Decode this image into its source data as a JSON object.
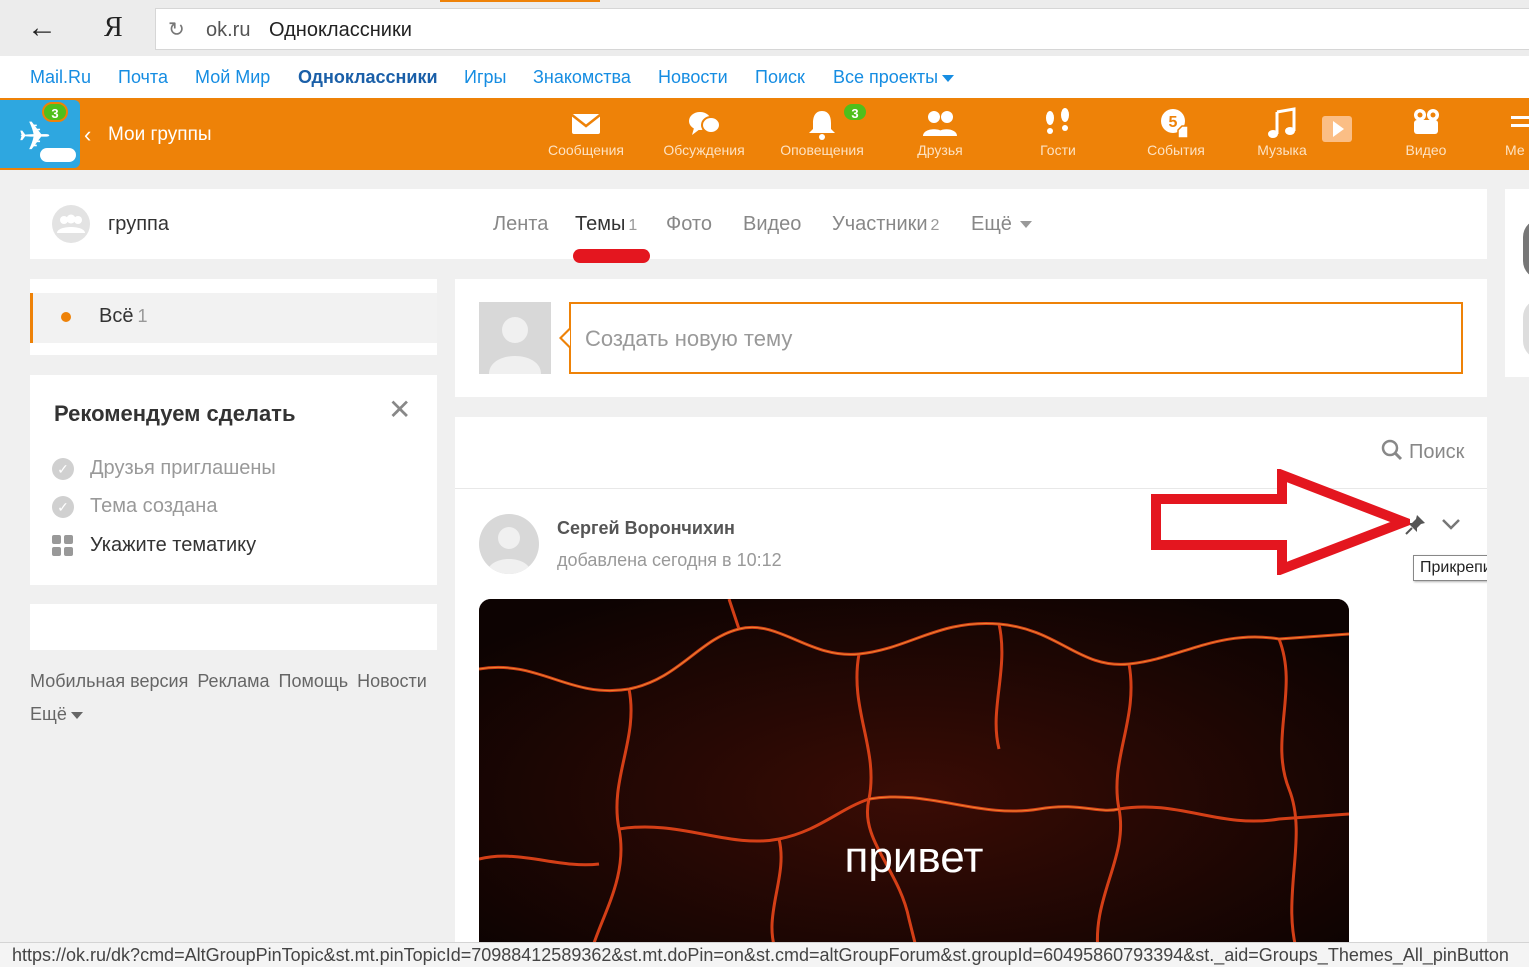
{
  "browser": {
    "back_icon": "arrow-left-icon",
    "logo": "Я",
    "domain": "ok.ru",
    "page_title": "Одноклассники"
  },
  "portal_nav": {
    "items": [
      "Mail.Ru",
      "Почта",
      "Мой Мир",
      "Одноклассники",
      "Игры",
      "Знакомства",
      "Новости",
      "Поиск",
      "Все проекты"
    ]
  },
  "header": {
    "logo_badge": "3",
    "section_title": "Мои группы",
    "nav": [
      {
        "label": "Сообщения",
        "icon": "envelope-icon"
      },
      {
        "label": "Обсуждения",
        "icon": "chat-bubbles-icon"
      },
      {
        "label": "Оповещения",
        "icon": "bell-icon",
        "badge": "3"
      },
      {
        "label": "Друзья",
        "icon": "friends-icon"
      },
      {
        "label": "Гости",
        "icon": "footprints-icon"
      },
      {
        "label": "События",
        "icon": "events-icon",
        "badge": "5"
      },
      {
        "label": "Музыка",
        "icon": "music-note-icon"
      },
      {
        "label": "Видео",
        "icon": "video-camera-icon"
      },
      {
        "label": "Ме",
        "icon": "menu-icon"
      }
    ],
    "accent_color": "#ee8208",
    "badge_color": "#4fbf1b"
  },
  "group": {
    "name": "группа",
    "tabs": [
      {
        "label": "Лента",
        "count": ""
      },
      {
        "label": "Темы",
        "count": "1"
      },
      {
        "label": "Фото",
        "count": ""
      },
      {
        "label": "Видео",
        "count": ""
      },
      {
        "label": "Участники",
        "count": "2"
      },
      {
        "label": "Ещё",
        "count": ""
      }
    ],
    "active_tab": "Темы"
  },
  "filter": {
    "label": "Всё",
    "count": "1"
  },
  "recommend": {
    "title": "Рекомендуем сделать",
    "items": [
      {
        "label": "Друзья приглашены",
        "done": true
      },
      {
        "label": "Тема создана",
        "done": true
      },
      {
        "label": "Укажите тематику",
        "done": false
      }
    ]
  },
  "footer": {
    "links": [
      "Мобильная версия",
      "Реклама",
      "Помощь",
      "Новости"
    ],
    "more": "Ещё"
  },
  "compose": {
    "placeholder": "Создать новую тему"
  },
  "topics": {
    "search_label": "Поиск",
    "post": {
      "author": "Сергей Ворончихин",
      "date": "добавлена сегодня в 10:12",
      "pin_tooltip": "Прикрепить",
      "image_text": "привет"
    }
  },
  "status_bar": {
    "url": "https://ok.ru/dk?cmd=AltGroupPinTopic&st.mt.pinTopicId=70988412589362&st.mt.doPin=on&st.cmd=altGroupForum&st.groupId=60495860793394&st._aid=Groups_Themes_All_pinButton"
  }
}
